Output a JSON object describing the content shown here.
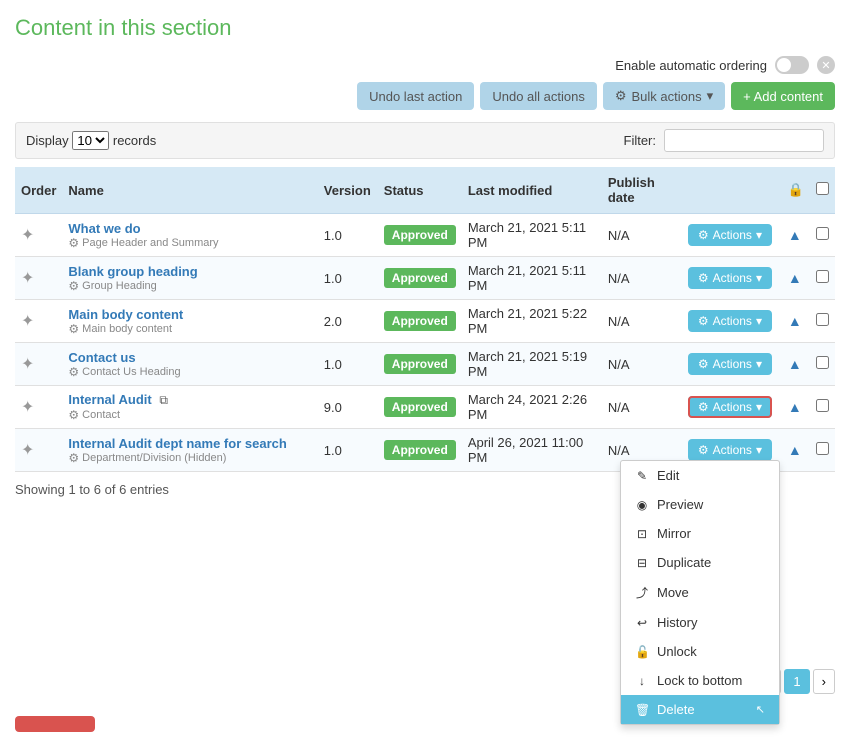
{
  "page": {
    "title": "Content in this section"
  },
  "toolbar": {
    "auto_order_label": "Enable automatic ordering",
    "undo_last_label": "Undo last action",
    "undo_all_label": "Undo all actions",
    "bulk_actions_label": "Bulk actions",
    "add_content_label": "+ Add content"
  },
  "table": {
    "display_label": "Display",
    "records_label": "records",
    "filter_label": "Filter:",
    "display_value": "10",
    "filter_value": "",
    "columns": [
      "Order",
      "Name",
      "Version",
      "Status",
      "Last modified",
      "Publish date",
      "",
      "",
      ""
    ],
    "rows": [
      {
        "name": "What we do",
        "type": "Page Header and Summary",
        "version": "1.0",
        "status": "Approved",
        "modified": "March 21, 2021 5:11 PM",
        "publish": "N/A",
        "actions_label": "Actions",
        "highlighted": false
      },
      {
        "name": "Blank group heading",
        "type": "Group Heading",
        "version": "1.0",
        "status": "Approved",
        "modified": "March 21, 2021 5:11 PM",
        "publish": "N/A",
        "actions_label": "Actions",
        "highlighted": false
      },
      {
        "name": "Main body content",
        "type": "Main body content",
        "version": "2.0",
        "status": "Approved",
        "modified": "March 21, 2021 5:22 PM",
        "publish": "N/A",
        "actions_label": "Actions",
        "highlighted": false
      },
      {
        "name": "Contact us",
        "type": "Contact Us Heading",
        "version": "1.0",
        "status": "Approved",
        "modified": "March 21, 2021 5:19 PM",
        "publish": "N/A",
        "actions_label": "Actions",
        "highlighted": false
      },
      {
        "name": "Internal Audit",
        "type": "Contact",
        "version": "9.0",
        "status": "Approved",
        "modified": "March 24, 2021 2:26 PM",
        "publish": "N/A",
        "actions_label": "Actions",
        "highlighted": true,
        "has_copy_icon": true
      },
      {
        "name": "Internal Audit dept name for search",
        "type": "Department/Division (Hidden)",
        "version": "1.0",
        "status": "Approved",
        "modified": "April 26, 2021 11:00 PM",
        "publish": "N/A",
        "actions_label": "Actions",
        "highlighted": false
      }
    ],
    "footer_text": "Showing 1 to 6 of 6 entries"
  },
  "dropdown_menu": {
    "items": [
      {
        "label": "Edit",
        "icon": "✎"
      },
      {
        "label": "Preview",
        "icon": "◉"
      },
      {
        "label": "Mirror",
        "icon": "⊡"
      },
      {
        "label": "Duplicate",
        "icon": "⊟"
      },
      {
        "label": "Move",
        "icon": "⤴"
      },
      {
        "label": "History",
        "icon": "↩"
      },
      {
        "label": "Unlock",
        "icon": "🔓"
      },
      {
        "label": "Lock to bottom",
        "icon": "↓"
      }
    ],
    "delete_label": "Delete"
  },
  "pagination": {
    "prev": "‹",
    "page": "1",
    "next": "›"
  }
}
